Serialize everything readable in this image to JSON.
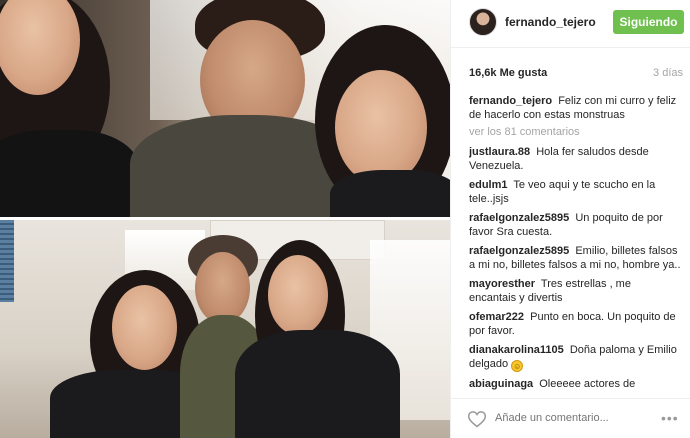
{
  "post": {
    "username": "fernando_tejero",
    "follow_label": "Siguiendo",
    "likes": "16,6k Me gusta",
    "time_ago": "3 días",
    "caption_user": "fernando_tejero",
    "caption_text": "Feliz con mi curro y feliz de hacerlo con estas monstruas",
    "view_all": "ver los 81 comentarios"
  },
  "comments": [
    {
      "user": "justlaura.88",
      "text": "Hola fer saludos desde Venezuela."
    },
    {
      "user": "edulm1",
      "text": "Te veo aqui y te scucho en la tele..jsjs"
    },
    {
      "user": "rafaelgonzalez5895",
      "text": "Un poquito de por favor Sra cuesta."
    },
    {
      "user": "rafaelgonzalez5895",
      "text": "Emilio, billetes falsos a mi no, billetes falsos a mi no, hombre ya.."
    },
    {
      "user": "mayoresther",
      "text": "Tres estrellas , me encantais y divertis"
    },
    {
      "user": "ofemar222",
      "text": "Punto en boca. Un poquito de por favor."
    },
    {
      "user": "dianakarolina1105",
      "text": "Doña paloma y Emilio delgado"
    },
    {
      "user": "abiaguinaga",
      "text": "Oleeeee actores de"
    }
  ],
  "footer": {
    "comment_placeholder": "Añade un comentario...",
    "more_label": "•••"
  },
  "icons": {
    "avatar": "avatar",
    "like": "heart-icon",
    "more": "more-options-icon",
    "emoji": "smiling-emoji-icon"
  },
  "colors": {
    "follow_button": "#70c050",
    "muted_text": "#a5a5a5",
    "border": "#efefef"
  }
}
